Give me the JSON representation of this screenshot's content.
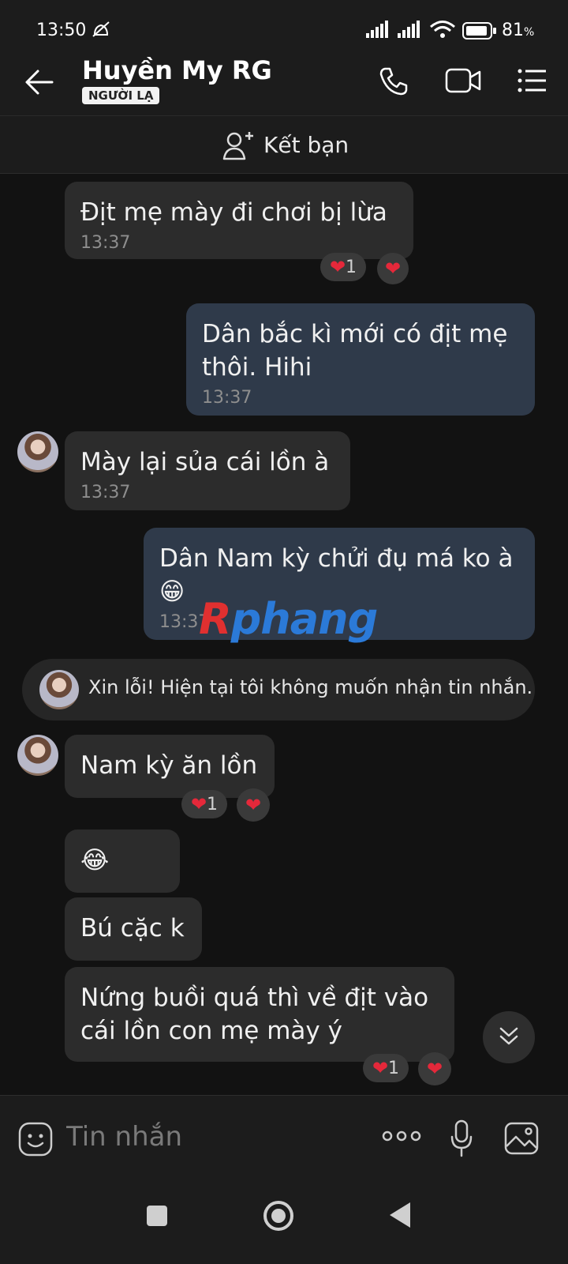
{
  "status": {
    "time": "13:50",
    "battery": "81",
    "battery_unit": "%"
  },
  "header": {
    "name": "Huyền My RG",
    "badge": "NGƯỜI LẠ"
  },
  "add_friend": {
    "label": "Kết bạn"
  },
  "messages": [
    {
      "dir": "in",
      "text": "Địt mẹ mày đi chơi bị lừa",
      "time": "13:37",
      "reaction_count": "1"
    },
    {
      "dir": "out",
      "text": "Dân bắc kì mới có địt mẹ thôi. Hihi",
      "time": "13:37"
    },
    {
      "dir": "in",
      "text": "Mày lại sủa cái lồn à",
      "time": "13:37"
    },
    {
      "dir": "out",
      "text": "Dân Nam kỳ chửi đụ má ko à 😁",
      "time": "13:37"
    },
    {
      "dir": "in",
      "text": "Nam kỳ ăn lồn",
      "reaction_count": "1"
    },
    {
      "dir": "in",
      "text": "😂"
    },
    {
      "dir": "in",
      "text": "Bú cặc k"
    },
    {
      "dir": "in",
      "text": "Nứng buồi quá thì về địt vào cái lồn con mẹ mày ý",
      "reaction_count": "1"
    }
  ],
  "system_message": "Xin lỗi! Hiện tại tôi không muốn nhận tin nhắn.",
  "watermark": {
    "part1": "R",
    "part2": "phang"
  },
  "composer": {
    "placeholder": "Tin nhắn"
  },
  "colors": {
    "accent_heart": "#e5283a",
    "bubble_in": "#2c2c2c",
    "bubble_out": "#2f3a4a"
  }
}
